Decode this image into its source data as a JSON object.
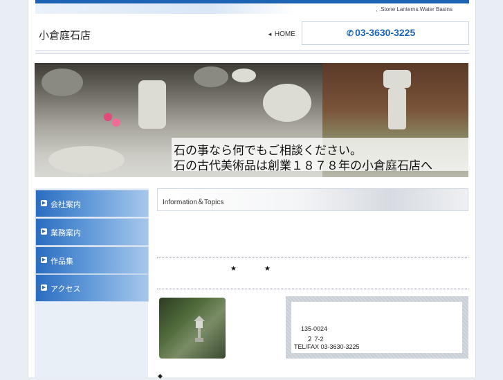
{
  "site": {
    "tagline": ".Stone Lanterns.Water Basins",
    "tagline_prefix": ",",
    "title": "小倉庭石店",
    "home_label": "HOME",
    "phone": "03-3630-3225"
  },
  "hero": {
    "line1": "石の事なら何でもご相談ください。",
    "line2": "石の古代美術品は創業１８７８年の小倉庭石店へ"
  },
  "sidebar": {
    "items": [
      {
        "label": "会社案内"
      },
      {
        "label": "業務案内"
      },
      {
        "label": "作品集"
      },
      {
        "label": "アクセス"
      }
    ]
  },
  "main": {
    "info_title": "Information＆Topics",
    "stars": [
      "★",
      "★"
    ],
    "address": {
      "postal": "135-0024",
      "street": "２ 7-2",
      "tel": "TEL/FAX 03-3630-3225"
    },
    "footer_mark": "◆"
  },
  "colors": {
    "accent": "#1f63b5",
    "phone": "#1a63b8",
    "nav_gradient_start": "#2a6cc0"
  },
  "icons": {
    "phone": "phone-icon",
    "home_arrow": "arrow-left-icon",
    "nav_bullet": "play-bullet-icon"
  }
}
